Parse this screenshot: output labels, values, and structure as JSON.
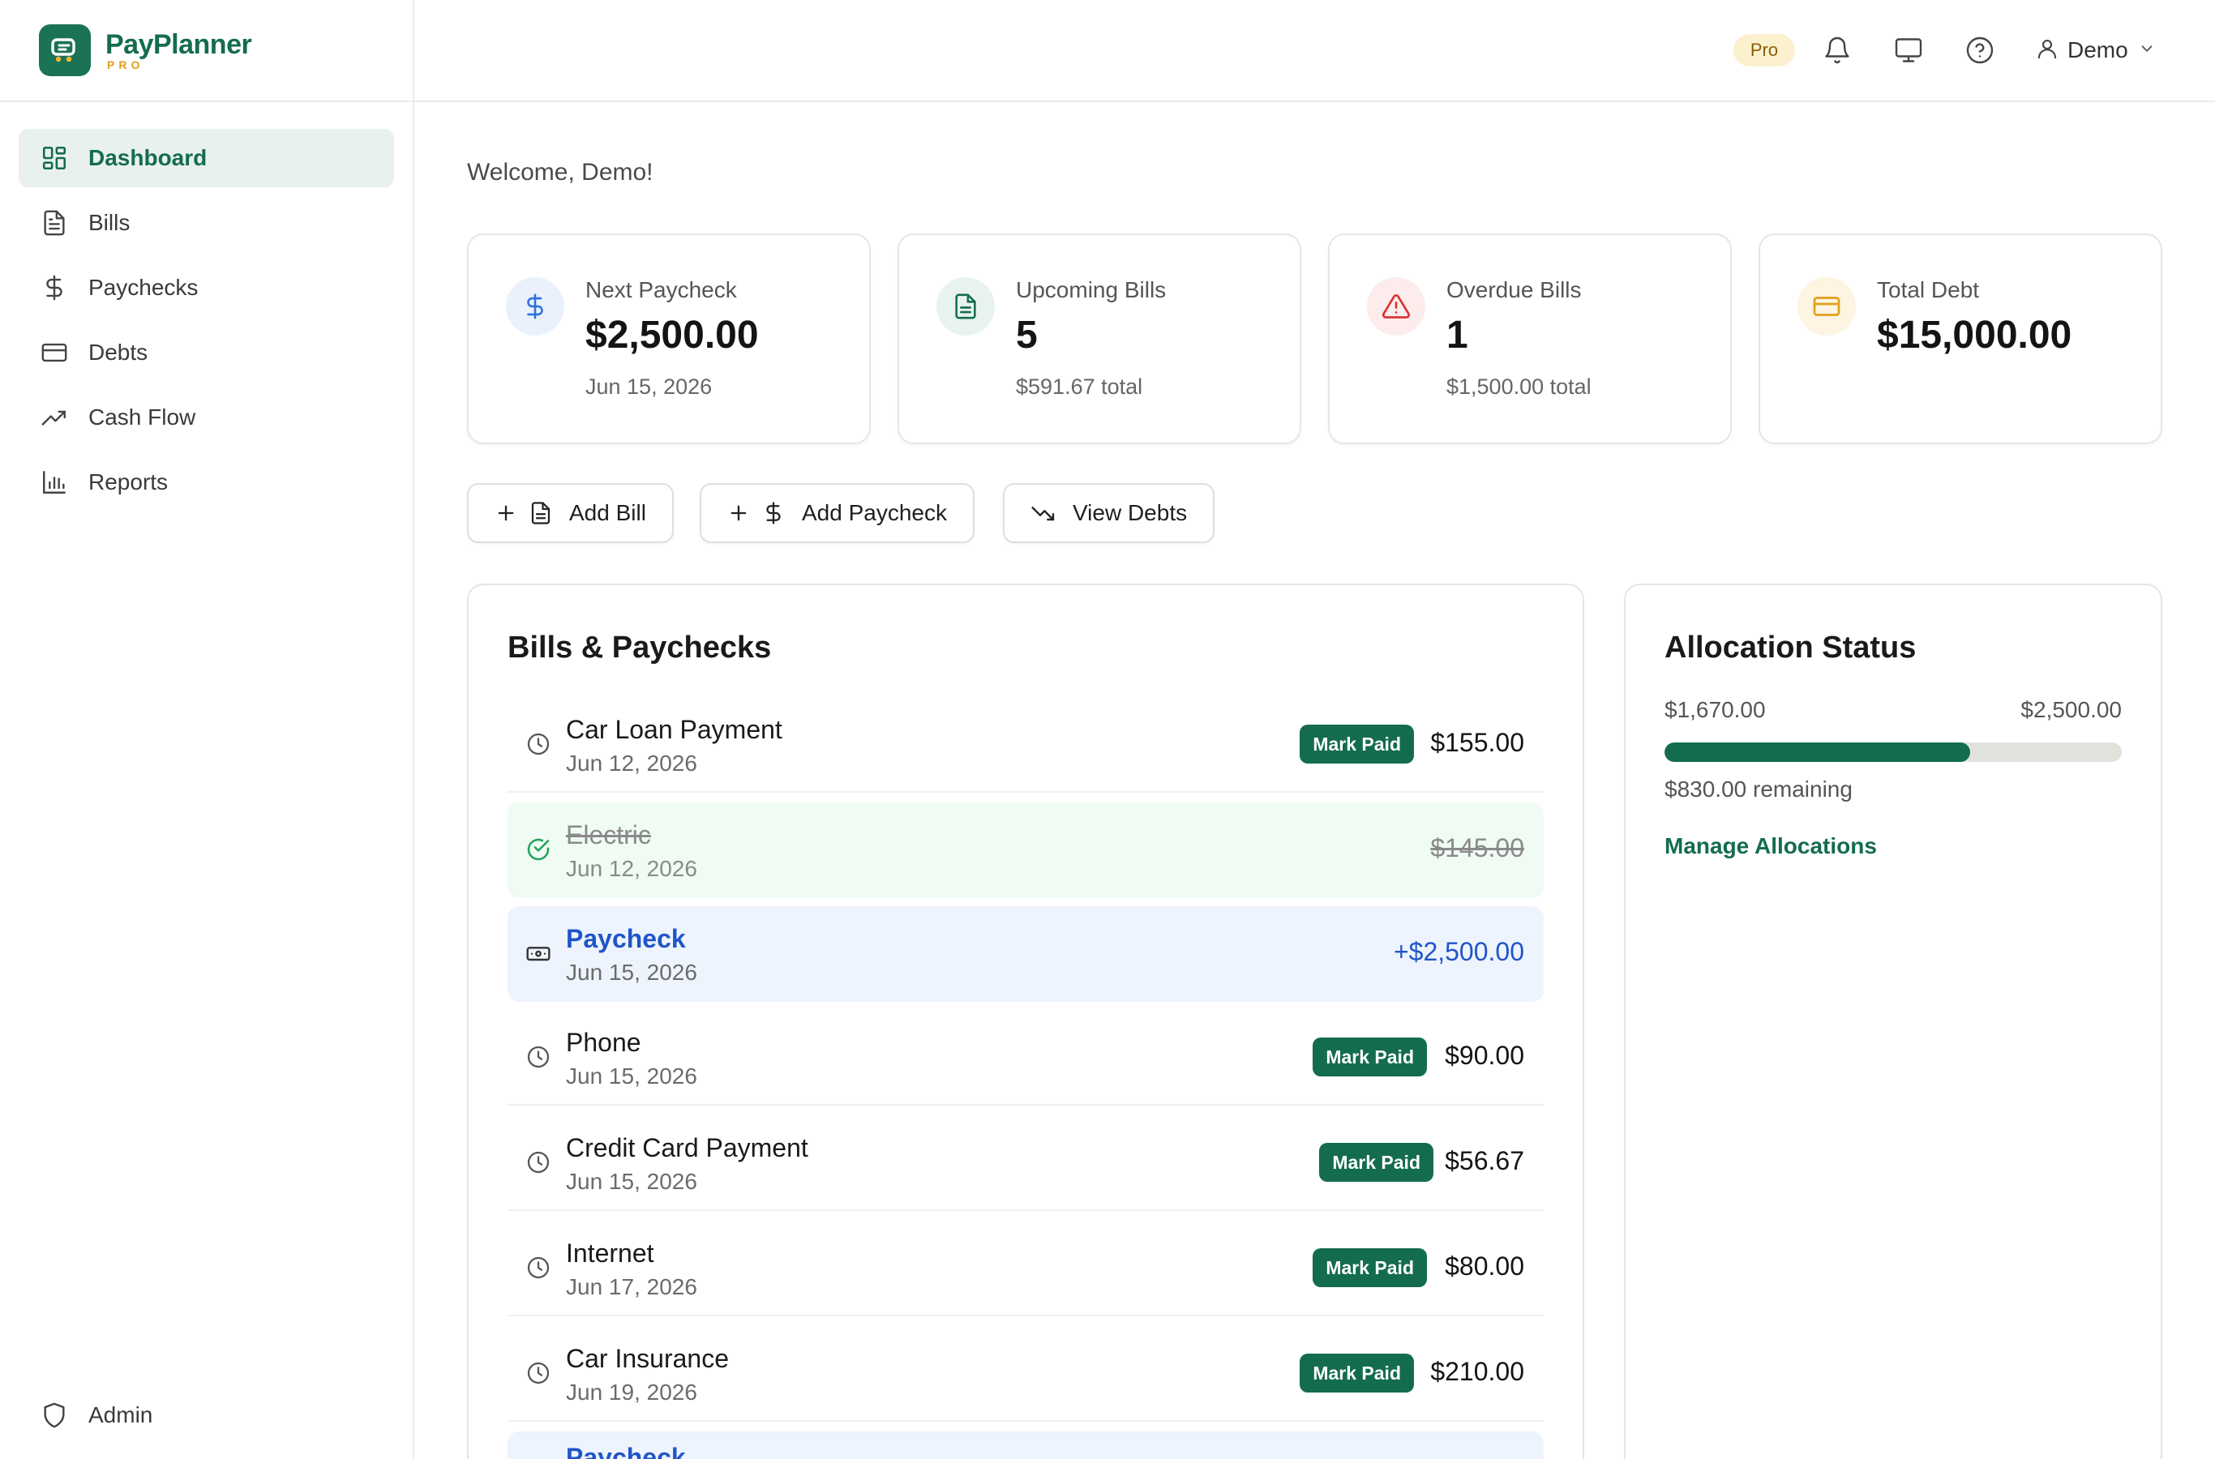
{
  "brand": {
    "name": "PayPlanner",
    "tier": "PRO"
  },
  "sidebar": {
    "items": [
      {
        "label": "Dashboard",
        "icon": "dashboard-icon",
        "active": true
      },
      {
        "label": "Bills",
        "icon": "document-icon"
      },
      {
        "label": "Paychecks",
        "icon": "dollar-icon"
      },
      {
        "label": "Debts",
        "icon": "credit-card-icon"
      },
      {
        "label": "Cash Flow",
        "icon": "trending-up-icon"
      },
      {
        "label": "Reports",
        "icon": "bar-chart-icon"
      }
    ],
    "admin": {
      "label": "Admin",
      "icon": "shield-icon"
    }
  },
  "header": {
    "badge": "Pro",
    "user": "Demo"
  },
  "welcome": "Welcome, Demo!",
  "stats": [
    {
      "label": "Next Paycheck",
      "value": "$2,500.00",
      "sub": "Jun 15, 2026",
      "icon": "dollar-icon",
      "color": "#2f6fdd"
    },
    {
      "label": "Upcoming Bills",
      "value": "5",
      "sub": "$591.67 total",
      "icon": "document-icon",
      "color": "#146c4f"
    },
    {
      "label": "Overdue Bills",
      "value": "1",
      "sub": "$1,500.00 total",
      "icon": "alert-triangle-icon",
      "color": "#d93535"
    },
    {
      "label": "Total Debt",
      "value": "$15,000.00",
      "sub": "",
      "icon": "credit-card-icon",
      "color": "#e0a11b"
    }
  ],
  "quick_actions": [
    {
      "label": "Add Bill"
    },
    {
      "label": "Add Paycheck"
    },
    {
      "label": "View Debts"
    }
  ],
  "bills_panel": {
    "title": "Bills & Paychecks",
    "mark_label": "Mark Paid",
    "rows": [
      {
        "name": "Car Loan Payment",
        "date": "Jun 12, 2026",
        "amount": "$155.00",
        "status": "upcoming"
      },
      {
        "name": "Electric",
        "date": "Jun 12, 2026",
        "amount": "$145.00",
        "status": "paid"
      },
      {
        "name": "Paycheck",
        "date": "Jun 15, 2026",
        "amount": "+$2,500.00",
        "status": "paycheck"
      },
      {
        "name": "Phone",
        "date": "Jun 15, 2026",
        "amount": "$90.00",
        "status": "upcoming"
      },
      {
        "name": "Credit Card Payment",
        "date": "Jun 15, 2026",
        "amount": "$56.67",
        "status": "upcoming"
      },
      {
        "name": "Internet",
        "date": "Jun 17, 2026",
        "amount": "$80.00",
        "status": "upcoming"
      },
      {
        "name": "Car Insurance",
        "date": "Jun 19, 2026",
        "amount": "$210.00",
        "status": "upcoming"
      },
      {
        "name": "Paycheck",
        "date": "",
        "amount": "",
        "status": "paycheck"
      }
    ]
  },
  "allocation": {
    "title": "Allocation Status",
    "allocated": "$1,670.00",
    "total": "$2,500.00",
    "fraction": 0.668,
    "remaining": "$830.00 remaining",
    "link": "Manage Allocations"
  },
  "colors": {
    "accent": "#146c4f",
    "paycheck": "#1f55c9",
    "paid_bg": "#effbf3",
    "paycheck_bg": "#eef4fd"
  }
}
